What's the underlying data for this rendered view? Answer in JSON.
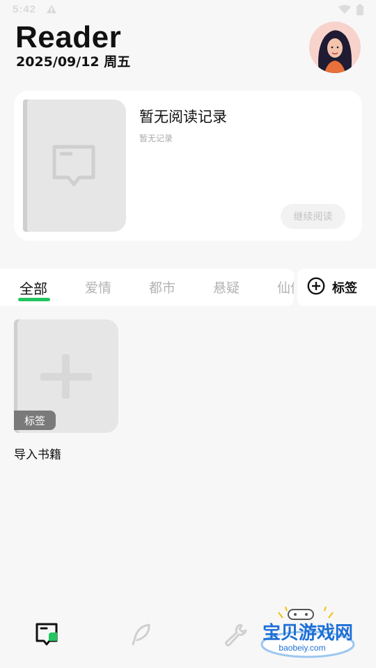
{
  "status_bar": {
    "time": "5:42"
  },
  "header": {
    "title": "Reader",
    "date": "2025/09/12 周五"
  },
  "recent": {
    "title": "暂无阅读记录",
    "subtitle": "暂无记录",
    "continue_label": "继续阅读"
  },
  "tabs": [
    {
      "label": "全部",
      "active": true
    },
    {
      "label": "爱情",
      "active": false
    },
    {
      "label": "都市",
      "active": false
    },
    {
      "label": "悬疑",
      "active": false
    },
    {
      "label": "仙侠",
      "active": false
    }
  ],
  "add_tag": {
    "label": "标签",
    "icon": "plus-circle-icon"
  },
  "books": [
    {
      "title": "导入书籍",
      "tag": "标签",
      "icon": "plus-icon"
    }
  ],
  "bottom_nav": [
    {
      "icon": "bookshelf-icon",
      "active": true
    },
    {
      "icon": "feather-icon",
      "active": false
    },
    {
      "icon": "wrench-icon",
      "active": false
    }
  ],
  "watermark": {
    "brand": "宝贝游戏网",
    "domain": "baobeiy.com"
  },
  "colors": {
    "accent": "#22c55e",
    "background": "#f7f7f7",
    "card": "#ffffff"
  }
}
